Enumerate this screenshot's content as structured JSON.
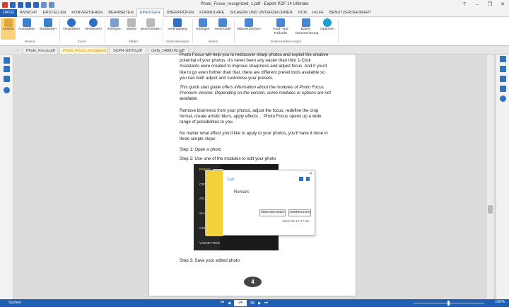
{
  "window": {
    "title": "Photo_Focus_recognized_1.pdf - Expert PDF 14 Ultimate",
    "controls": [
      "?",
      "–",
      "❐",
      "✕"
    ]
  },
  "menu": [
    "DATEI",
    "ANSICHT",
    "ERSTELLEN",
    "KONVERTIEREN",
    "BEARBEITEN",
    "EINFÜGEN",
    "ÜBERPRÜFEN",
    "FORMULARE",
    "SICHERN UND UNTERZEICHNEN",
    "OCR",
    "HILFE",
    "BENUTZERDEFINIERT"
  ],
  "ribbon": {
    "buttons": [
      "Ansicht",
      "Auswählen",
      "Bearbeiten",
      "Vergrößern",
      "Verkleinern",
      "Einfügen",
      "Maske",
      "Beschneiden",
      "Verknüpfung",
      "Einfügen",
      "Seitenzahl",
      "Wasserzeichen",
      "Kopf- und Fußzeile",
      "Bates- Nummerierung",
      "Optionen"
    ],
    "groups": [
      "Modus",
      "Zoom",
      "Bilder",
      "Verknüpfungen",
      "Seiten",
      "Seitenmarkierungen"
    ]
  },
  "tabs": [
    "Photo_Focus.pdf",
    "Photo_Focus_recognized_...",
    "SCPH-10070.pdf",
    "cerfa_14880-02.pdf"
  ],
  "page": {
    "p1": "Photo Focus will help you to rediscover sharp photos and exploit the creative potential of your photos. It's never been any easier than this! 1-Click Assistants were created to improve sharpness and adjust focus. And if you'd like to go even further than that, there are different preset tools available so you can both adjust and customise your presets.",
    "p2": "This quick start guide offers information about the modules of Photo Focus Premium version. Depending on the version, some modules or options are not available.",
    "p3": "Remove blurriness from your photos, adjust the focus, redefine the crop format, create artistic blurs, apply effects… Photo Focus opens up a wide range of possibilities to you.",
    "p4": "No matter what effect you'd like to apply to your photos, you'll have it done in three simple steps:",
    "s1": "Step 1: Open a photo",
    "s2": "Step 2: Use one of the modules to edit your photo",
    "s3": "Step 3: Save your edited photo",
    "pagenum": "4",
    "shot_labels": [
      "PRESE",
      "CROP",
      "ADJUS",
      "SHARP",
      "CREAT",
      "VIGNETTING"
    ]
  },
  "note": {
    "author": "Luc",
    "remark": "Remark:",
    "ok": "ÜBERNEHMEN",
    "cancel": "ABBRECHEN",
    "date": "2019-06-10 17:35",
    "close": "✕"
  },
  "status": {
    "search": "Suchen",
    "page": "24",
    "of": "38",
    "zoom": "150%"
  }
}
